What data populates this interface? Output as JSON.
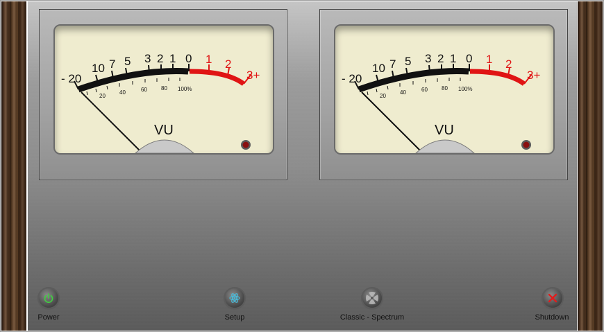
{
  "meters": [
    {
      "id": "left",
      "label": "VU",
      "db_scale": [
        "- 20",
        "10",
        "7",
        "5",
        "3",
        "2",
        "1",
        "0",
        "1",
        "2",
        "3+"
      ],
      "percent_scale": [
        "20",
        "40",
        "60",
        "80",
        "100%"
      ],
      "needle_level": "-20"
    },
    {
      "id": "right",
      "label": "VU",
      "db_scale": [
        "- 20",
        "10",
        "7",
        "5",
        "3",
        "2",
        "1",
        "0",
        "1",
        "2",
        "3+"
      ],
      "percent_scale": [
        "20",
        "40",
        "60",
        "80",
        "100%"
      ],
      "needle_level": "-20"
    }
  ],
  "controls": {
    "power": {
      "label": "Power",
      "icon": "power-icon",
      "icon_color": "#3fd13f"
    },
    "setup": {
      "label": "Setup",
      "icon": "atom-icon",
      "icon_color": "#4ab8d6"
    },
    "classic_spectrum": {
      "label": "Classic - Spectrum",
      "icon": "fan-icon",
      "icon_color": "#bdbdbd"
    },
    "shutdown": {
      "label": "Shutdown",
      "icon": "close-icon",
      "icon_color": "#e01e1e"
    }
  },
  "colors": {
    "meter_face": "#efeccf",
    "scale_black": "#111111",
    "scale_red": "#e01414",
    "peak_led": "#8a1010"
  }
}
